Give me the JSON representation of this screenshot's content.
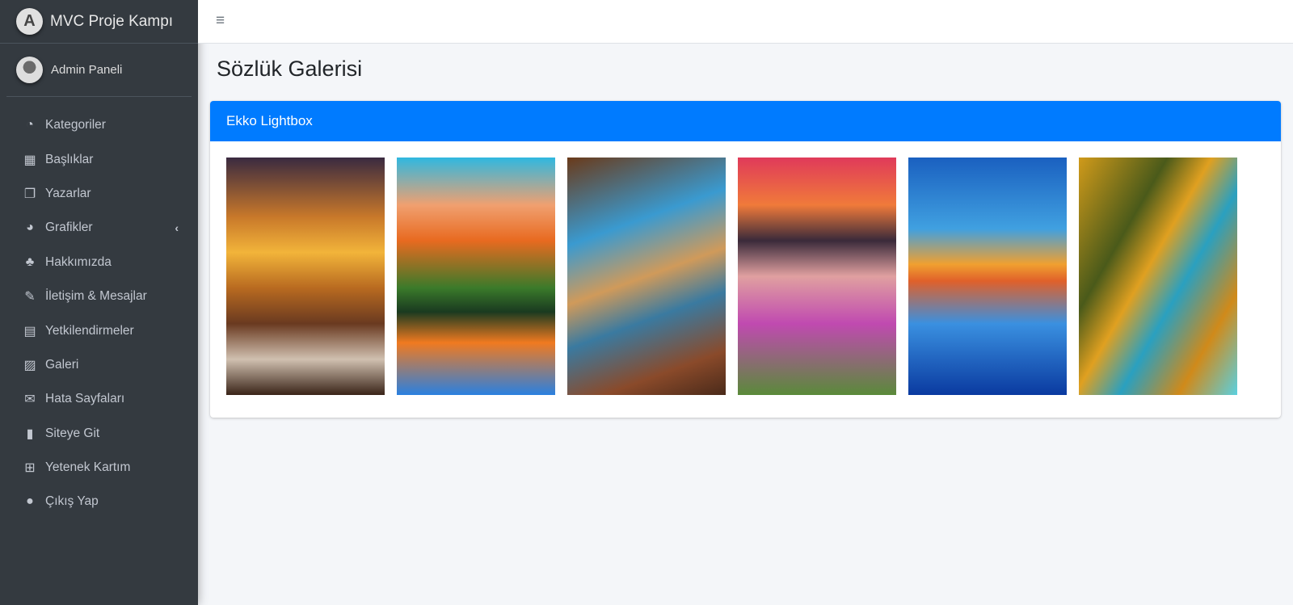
{
  "brand": {
    "title": "MVC Proje Kampı",
    "logo_letter": "A"
  },
  "user": {
    "name": "Admin Paneli"
  },
  "sidebar": {
    "items": [
      {
        "label": "Kategoriler",
        "icon": "tachometer-icon",
        "glyph": "◔"
      },
      {
        "label": "Başlıklar",
        "icon": "grid-icon",
        "glyph": "▦"
      },
      {
        "label": "Yazarlar",
        "icon": "copy-icon",
        "glyph": "❐"
      },
      {
        "label": "Grafikler",
        "icon": "pie-chart-icon",
        "glyph": "◕"
      },
      {
        "label": "Hakkımızda",
        "icon": "tree-icon",
        "glyph": "♣"
      },
      {
        "label": "İletişim & Mesajlar",
        "icon": "edit-icon",
        "glyph": "✎"
      },
      {
        "label": "Yetkilendirmeler",
        "icon": "calendar-icon",
        "glyph": "▤"
      },
      {
        "label": "Galeri",
        "icon": "image-icon",
        "glyph": "▨"
      },
      {
        "label": "Hata Sayfaları",
        "icon": "envelope-icon",
        "glyph": "✉"
      },
      {
        "label": "Siteye Git",
        "icon": "book-icon",
        "glyph": "▮"
      },
      {
        "label": "Yetenek Kartım",
        "icon": "table-icon",
        "glyph": "⊞"
      },
      {
        "label": "Çıkış Yap",
        "icon": "apple-icon",
        "glyph": "●"
      }
    ]
  },
  "header": {
    "menu_glyph": "≡"
  },
  "page": {
    "title": "Sözlük Galerisi"
  },
  "card": {
    "title": "Ekko Lightbox"
  },
  "colors": {
    "sidebar": "#343a40",
    "accent": "#007bff",
    "background": "#f4f6f9"
  }
}
